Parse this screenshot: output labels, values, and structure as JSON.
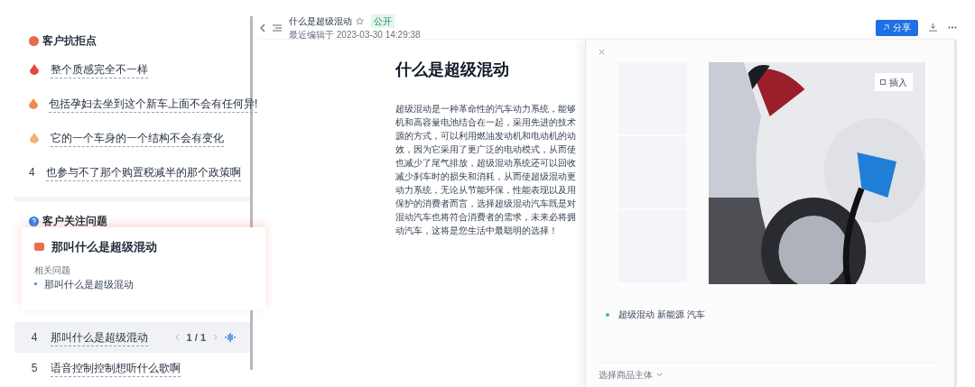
{
  "objections": {
    "title": "客户抗拒点",
    "items": [
      {
        "kind": "medal",
        "color": "#e8473c",
        "text": "整个质感完全不一样"
      },
      {
        "kind": "medal",
        "color": "#ef8a4a",
        "text": "包括孕妇去坐到这个新车上面不会有任何异!"
      },
      {
        "kind": "medal",
        "color": "#f3b27a",
        "text": "它的一个车身的一个结构不会有变化"
      },
      {
        "kind": "number",
        "number": "4",
        "text": "也参与不了那个购置税减半的那个政策啊"
      }
    ]
  },
  "concerns": {
    "title": "客户关注问题",
    "items": [
      {
        "number": "4",
        "text": "那叫什么是超级混动",
        "selected": true,
        "pager": "1 / 1"
      },
      {
        "number": "5",
        "text": "语音控制控制想听什么歌啊",
        "selected": false
      }
    ]
  },
  "popup": {
    "title": "那叫什么是超级混动",
    "related_label": "相关问题",
    "related": [
      "那叫什么是超级混动"
    ]
  },
  "header": {
    "title": "什么是超级混动",
    "badge": "公开",
    "edited": "最近编辑于 2023-03-30 14:29:38",
    "share": "分享"
  },
  "article": {
    "title": "什么是超级混动",
    "lines": [
      "超级混动是一种革命性的汽车动力系统，能够",
      "机和高容量电池结合在一起，采用先进的技术",
      "源的方式，可以利用燃油发动机和电动机的动",
      "效，因为它采用了更广泛的电动模式，从而使",
      "也减少了尾气排放，超级混动系统还可以回收",
      "减少刹车时的损失和消耗，从而使超级混动更",
      "动力系统，无论从节能环保，性能表现以及用",
      "保护的消费者而言，选择超级混动汽车既是对",
      "混动汽车也将符合消费者的需求，未来必将拥",
      "动汽车，这将是您生活中最聪明的选择！"
    ]
  },
  "panel": {
    "insert": "插入",
    "tags": "超级混动 新能源 汽车",
    "product_select": "选择商品主体"
  }
}
